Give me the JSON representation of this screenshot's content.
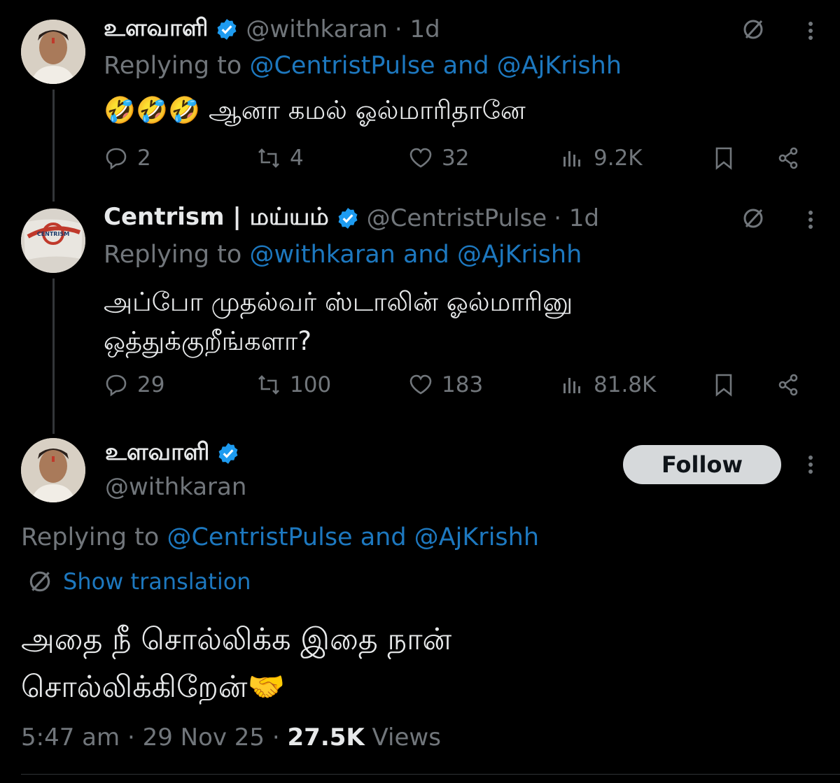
{
  "replies": [
    {
      "name": "உளவாளி",
      "handle": "@withkaran",
      "time": "· 1d",
      "replying_prefix": "Replying to",
      "replying_users": "@CentristPulse and @AjKrishh",
      "text": "🤣🤣🤣 ஆனா கமல் ஓல்மாரிதானே",
      "stats": {
        "replies": "2",
        "reposts": "4",
        "likes": "32",
        "views": "9.2K"
      }
    },
    {
      "name": "Centrism | மய்யம்",
      "handle": "@CentristPulse",
      "time": "· 1d",
      "replying_prefix": "Replying to",
      "replying_users": "@withkaran and @AjKrishh",
      "text_line1": "அப்போ முதல்வர் ஸ்டாலின் ஓல்மாரினு",
      "text_line2": "ஒத்துக்குறீங்களா?",
      "stats": {
        "replies": "29",
        "reposts": "100",
        "likes": "183",
        "views": "81.8K"
      },
      "avatar_label": "CENTRISM"
    }
  ],
  "main_tweet": {
    "name": "உளவாளி",
    "handle": "@withkaran",
    "follow_label": "Follow",
    "replying_prefix": "Replying to",
    "replying_users": "@CentristPulse and @AjKrishh",
    "show_translation": "Show translation",
    "text_line1": "அதை நீ சொல்லிக்க இதை நான்",
    "text_line2": "சொல்லிக்கிறேன்🤝",
    "time": "5:47 am",
    "date": "29 Nov 25",
    "views_count": "27.5K",
    "views_label": "Views"
  },
  "colors": {
    "background": "#000000",
    "link": "#1d78bf",
    "muted": "#71767b",
    "verified": "#1d9bf0"
  }
}
